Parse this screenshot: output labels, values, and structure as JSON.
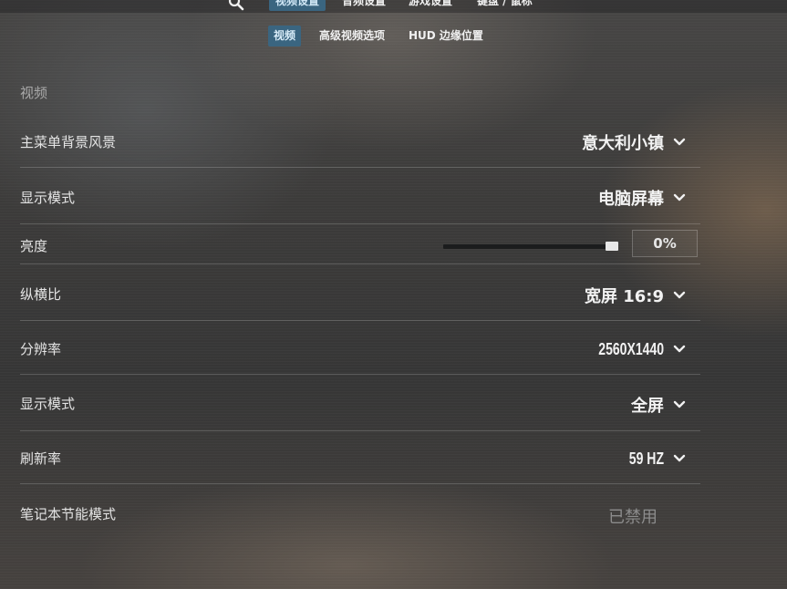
{
  "top_nav": {
    "search_icon": "search-icon",
    "tabs": [
      {
        "label": "视频设置",
        "active": true
      },
      {
        "label": "音频设置",
        "active": false
      },
      {
        "label": "游戏设置",
        "active": false
      },
      {
        "label": "键盘 / 鼠标",
        "active": false
      }
    ]
  },
  "sub_tabs": [
    {
      "label": "视频",
      "active": true
    },
    {
      "label": "高级视频选项",
      "active": false
    },
    {
      "label": "HUD 边缘位置",
      "active": false
    }
  ],
  "section_title": "视频",
  "settings": {
    "menu_background": {
      "label": "主菜单背景风景",
      "value": "意大利小镇"
    },
    "display_mode_1": {
      "label": "显示模式",
      "value": "电脑屏幕"
    },
    "brightness": {
      "label": "亮度",
      "value_text": "0%",
      "level": 0
    },
    "aspect_ratio": {
      "label": "纵横比",
      "value": "宽屏 16:9"
    },
    "resolution": {
      "label": "分辨率",
      "value": "2560X1440"
    },
    "display_mode_2": {
      "label": "显示模式",
      "value": "全屏"
    },
    "refresh_rate": {
      "label": "刷新率",
      "value": "59 HZ"
    },
    "laptop_power_saving": {
      "label": "笔记本节能模式",
      "value": "已禁用"
    }
  },
  "colors": {
    "accent_tab": "#3a6580",
    "text_primary": "#f2f2f2",
    "text_disabled": "#8c8c8c"
  }
}
